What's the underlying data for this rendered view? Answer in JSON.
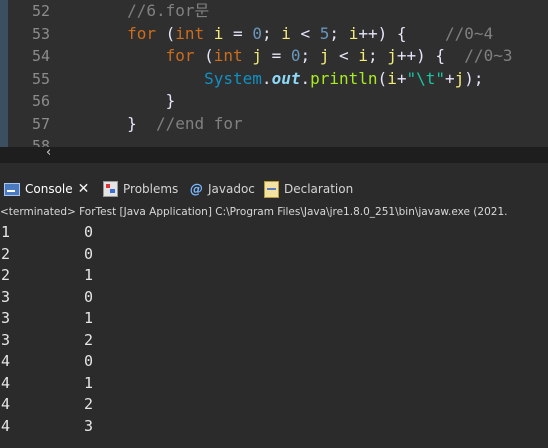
{
  "editor": {
    "lines": [
      {
        "no": "52",
        "tokens": [
          {
            "t": "        ",
            "c": ""
          },
          {
            "t": "//6.for문",
            "c": "cmt"
          }
        ]
      },
      {
        "no": "53",
        "tokens": [
          {
            "t": "        ",
            "c": ""
          },
          {
            "t": "for",
            "c": "kw"
          },
          {
            "t": " (",
            "c": "op"
          },
          {
            "t": "int",
            "c": "typ"
          },
          {
            "t": " ",
            "c": ""
          },
          {
            "t": "i",
            "c": "var"
          },
          {
            "t": " = ",
            "c": "op"
          },
          {
            "t": "0",
            "c": "num"
          },
          {
            "t": "; ",
            "c": "op"
          },
          {
            "t": "i",
            "c": "var"
          },
          {
            "t": " < ",
            "c": "op"
          },
          {
            "t": "5",
            "c": "num"
          },
          {
            "t": "; ",
            "c": "op"
          },
          {
            "t": "i",
            "c": "var"
          },
          {
            "t": "++) {    ",
            "c": "op"
          },
          {
            "t": "//0~4",
            "c": "cmt"
          }
        ]
      },
      {
        "no": "54",
        "tokens": [
          {
            "t": "            ",
            "c": ""
          },
          {
            "t": "for",
            "c": "kw"
          },
          {
            "t": " (",
            "c": "op"
          },
          {
            "t": "int",
            "c": "typ"
          },
          {
            "t": " ",
            "c": ""
          },
          {
            "t": "j",
            "c": "var"
          },
          {
            "t": " = ",
            "c": "op"
          },
          {
            "t": "0",
            "c": "num"
          },
          {
            "t": "; ",
            "c": "op"
          },
          {
            "t": "j",
            "c": "var"
          },
          {
            "t": " < ",
            "c": "op"
          },
          {
            "t": "i",
            "c": "var"
          },
          {
            "t": "; ",
            "c": "op"
          },
          {
            "t": "j",
            "c": "var"
          },
          {
            "t": "++) {  ",
            "c": "op"
          },
          {
            "t": "//0~3",
            "c": "cmt"
          }
        ]
      },
      {
        "no": "55",
        "tokens": [
          {
            "t": "                ",
            "c": ""
          },
          {
            "t": "System",
            "c": "cls"
          },
          {
            "t": ".",
            "c": "op"
          },
          {
            "t": "out",
            "c": "fld"
          },
          {
            "t": ".",
            "c": "op"
          },
          {
            "t": "println",
            "c": "mth"
          },
          {
            "t": "(",
            "c": "op"
          },
          {
            "t": "i",
            "c": "var"
          },
          {
            "t": "+",
            "c": "op"
          },
          {
            "t": "\"\\t\"",
            "c": "str"
          },
          {
            "t": "+",
            "c": "op"
          },
          {
            "t": "j",
            "c": "var"
          },
          {
            "t": ");",
            "c": "op"
          }
        ]
      },
      {
        "no": "56",
        "tokens": [
          {
            "t": "            ",
            "c": ""
          },
          {
            "t": "}",
            "c": "op"
          }
        ]
      },
      {
        "no": "57",
        "tokens": [
          {
            "t": "        ",
            "c": ""
          },
          {
            "t": "}",
            "c": "op"
          },
          {
            "t": "  ",
            "c": ""
          },
          {
            "t": "//end for",
            "c": "cmt"
          }
        ]
      },
      {
        "no": "58",
        "tokens": []
      }
    ],
    "scroll_left_glyph": "‹"
  },
  "tabs": {
    "console": {
      "label": "Console",
      "close": "✕"
    },
    "problems": {
      "label": "Problems"
    },
    "javadoc": {
      "label": "Javadoc",
      "icon_glyph": "@"
    },
    "declaration": {
      "label": "Declaration"
    }
  },
  "console": {
    "status": "<terminated> ForTest [Java Application] C:\\Program Files\\Java\\jre1.8.0_251\\bin\\javaw.exe  (2021.",
    "rows": [
      [
        "1",
        "0"
      ],
      [
        "2",
        "0"
      ],
      [
        "2",
        "1"
      ],
      [
        "3",
        "0"
      ],
      [
        "3",
        "1"
      ],
      [
        "3",
        "2"
      ],
      [
        "4",
        "0"
      ],
      [
        "4",
        "1"
      ],
      [
        "4",
        "2"
      ],
      [
        "4",
        "3"
      ]
    ]
  }
}
